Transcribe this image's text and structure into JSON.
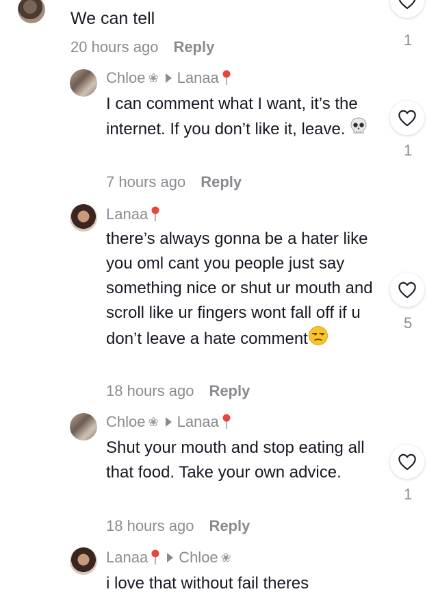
{
  "comments": [
    {
      "author": "",
      "text": "We can tell",
      "time": "20 hours ago",
      "reply_label": "Reply",
      "likes": "1"
    },
    {
      "author": "Chloe",
      "reply_to": "Lanaa",
      "text": " I can comment what I want, it’s the internet. If you don’t like it, leave.",
      "time": "7 hours ago",
      "reply_label": "Reply",
      "likes": "1"
    },
    {
      "author": "Lanaa",
      "text": "there’s always gonna be a hater like you oml cant you people just say something nice or shut ur mouth and scroll like ur fingers wont fall off if u don’t leave a hate comment",
      "time": "18 hours ago",
      "reply_label": "Reply",
      "likes": "5"
    },
    {
      "author": "Chloe",
      "reply_to": "Lanaa",
      "text": " Shut your mouth and stop eating all that food. Take your own advice.",
      "time": "18 hours ago",
      "reply_label": "Reply",
      "likes": "1"
    },
    {
      "author": "Lanaa",
      "reply_to": "Chloe",
      "text": "i love that without fail theres"
    }
  ],
  "icons": {
    "like": "heart-outline-icon",
    "pin": "pin-icon",
    "flower": "flower-icon",
    "skull": "skull-emoji",
    "unamused": "unamused-face-emoji"
  },
  "colors": {
    "text": "#161823",
    "secondary": "#8a8b91",
    "pin_red": "#e8453c"
  }
}
